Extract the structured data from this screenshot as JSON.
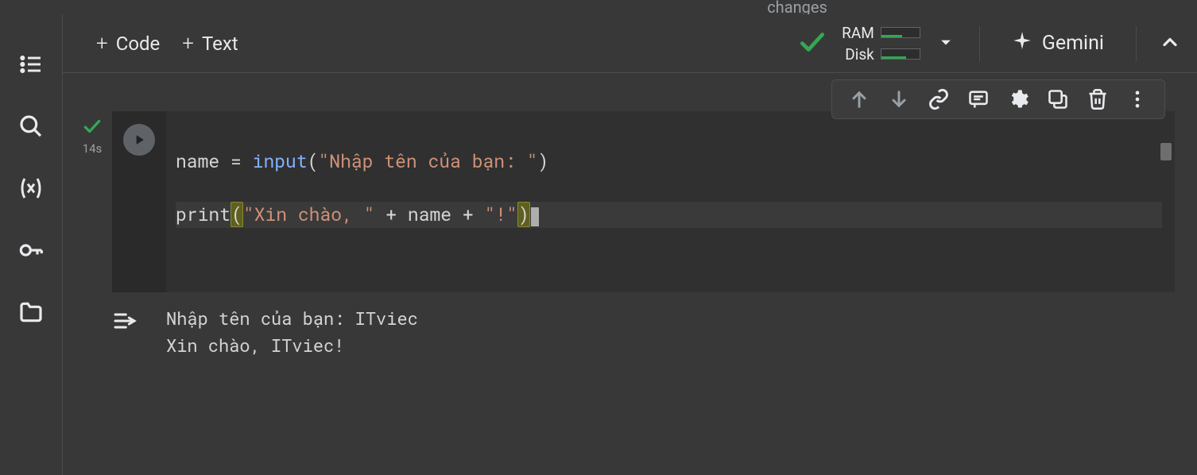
{
  "banner_text": "changes",
  "toolbar": {
    "code_label": "Code",
    "text_label": "Text",
    "ram_label": "RAM",
    "disk_label": "Disk",
    "gemini_label": "Gemini"
  },
  "cell": {
    "exec_time": "14s",
    "code": {
      "line1": {
        "var": "name",
        "assign": " = ",
        "func": "input",
        "open": "(",
        "str": "\"Nhập tên của bạn: \"",
        "close": ")"
      },
      "line2": {
        "func": "print",
        "open": "(",
        "str1": "\"Xin chào, \"",
        "op1": " + ",
        "var": "name",
        "op2": " + ",
        "str2": "\"!\"",
        "close": ")"
      }
    },
    "output": {
      "line1": "Nhập tên của bạn: ITviec",
      "line2": "Xin chào, ITviec!"
    }
  }
}
